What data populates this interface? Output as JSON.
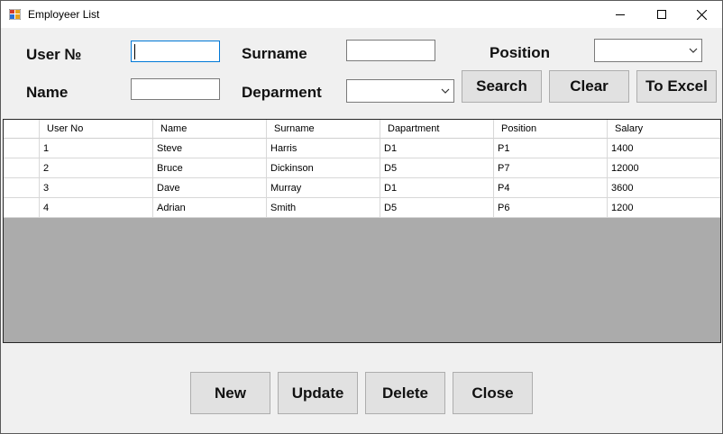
{
  "window": {
    "title": "Employeer List"
  },
  "search": {
    "user_no_label": "User №",
    "name_label": "Name",
    "surname_label": "Surname",
    "department_label": "Deparment",
    "position_label": "Position",
    "user_no_value": "",
    "name_value": "",
    "surname_value": "",
    "department_value": "",
    "position_value": ""
  },
  "buttons": {
    "search": "Search",
    "clear": "Clear",
    "to_excel": "To Excel",
    "new": "New",
    "update": "Update",
    "delete": "Delete",
    "close": "Close"
  },
  "table": {
    "columns": [
      "User No",
      "Name",
      "Surname",
      "Dapartment",
      "Position",
      "Salary"
    ],
    "rows": [
      [
        "1",
        "Steve",
        "Harris",
        "D1",
        "P1",
        "1400"
      ],
      [
        "2",
        "Bruce",
        "Dickinson",
        "D5",
        "P7",
        "12000"
      ],
      [
        "3",
        "Dave",
        "Murray",
        "D1",
        "P4",
        "3600"
      ],
      [
        "4",
        "Adrian",
        "Smith",
        "D5",
        "P6",
        "1200"
      ]
    ]
  },
  "colors": {
    "focus_border": "#0078d7",
    "grid_background": "#ababab",
    "button_face": "#e1e1e1"
  },
  "icons": [
    "app-icon",
    "minimize-icon",
    "maximize-icon",
    "close-icon",
    "chevron-down-icon"
  ]
}
